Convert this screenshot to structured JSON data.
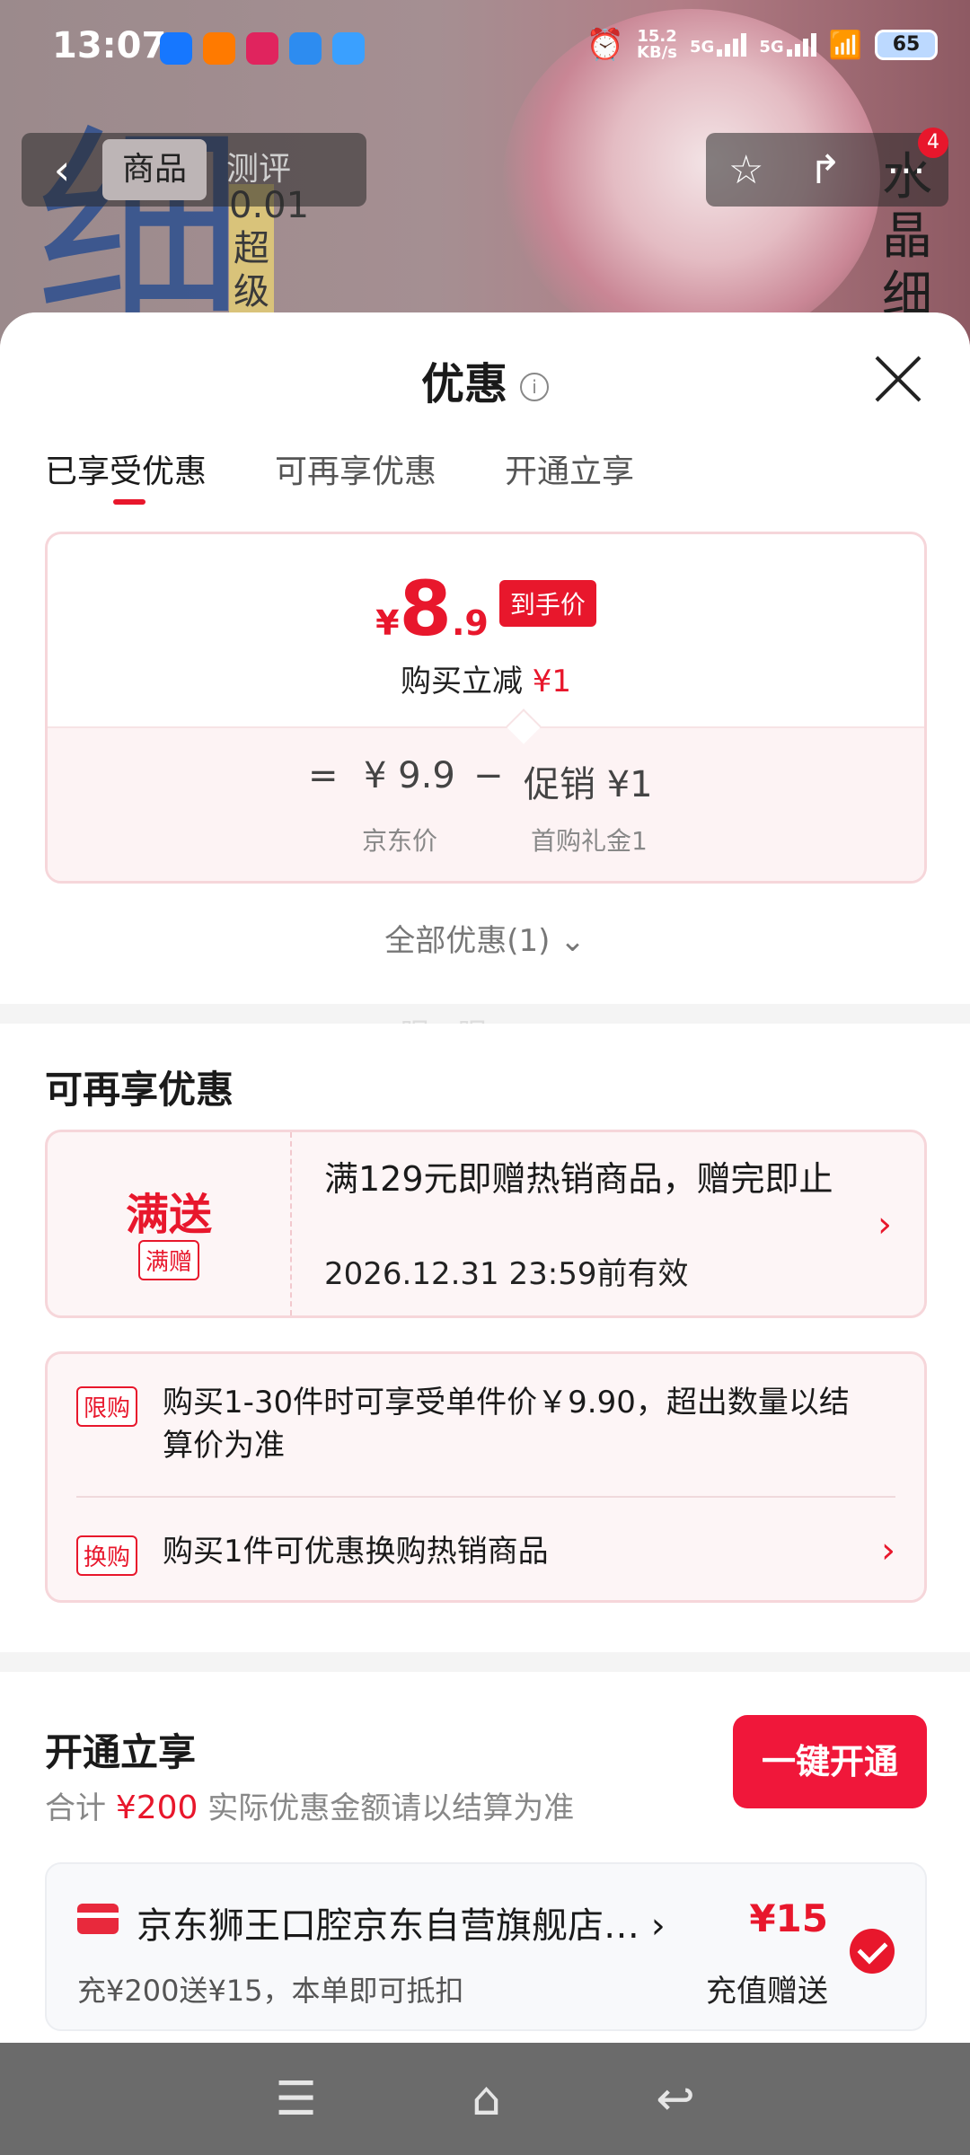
{
  "status_bar": {
    "time": "13:07",
    "net_speed_value": "15.2",
    "net_speed_unit": "KB/s",
    "signal1": "5G",
    "signal2": "5G",
    "battery": "65"
  },
  "background": {
    "big_char": "细",
    "side_text": "0.01 超 级",
    "right_text": "水 晶 细"
  },
  "nav": {
    "tab_product": "商品",
    "tab_review": "测评",
    "cart_count": "4"
  },
  "sheet": {
    "title": "优惠",
    "tabs": [
      "已享受优惠",
      "可再享优惠",
      "开通立享"
    ],
    "price": {
      "yen": "¥",
      "integer": "8",
      "decimal": ".9",
      "badge": "到手价",
      "reduce_label": "购买立减",
      "reduce_value": "¥1"
    },
    "formula": {
      "equals": "=",
      "base_price": "¥ 9.9",
      "minus": "−",
      "promo_text": "促销 ¥1",
      "base_label": "京东价",
      "promo_label": "首购礼金1"
    },
    "all_discounts": "全部优惠(1)",
    "ghost_text": "眠一眠"
  },
  "more_offers": {
    "heading": "可再享优惠",
    "gift": {
      "title": "满送",
      "tag": "满赠",
      "desc": "满129元即赠热销商品，赠完即止",
      "valid": "2026.12.31 23:59前有效"
    },
    "limit": {
      "tag": "限购",
      "text": "购买1-30件时可享受单件价￥9.90，超出数量以结算价为准"
    },
    "exchange": {
      "tag": "换购",
      "text": "购买1件可优惠换购热销商品"
    }
  },
  "open_section": {
    "heading": "开通立享",
    "total_prefix": "合计",
    "total_value": "¥200",
    "total_suffix": "实际优惠金额请以结算为准",
    "button": "一键开通",
    "store_name": "京东狮王口腔京东自营旗舰店…",
    "store_sub": "充¥200送¥15，本单即可抵扣",
    "amount": "¥15",
    "amount_type": "充值赠送"
  },
  "colors": {
    "accent": "#e8172c",
    "button": "#f0173a"
  }
}
